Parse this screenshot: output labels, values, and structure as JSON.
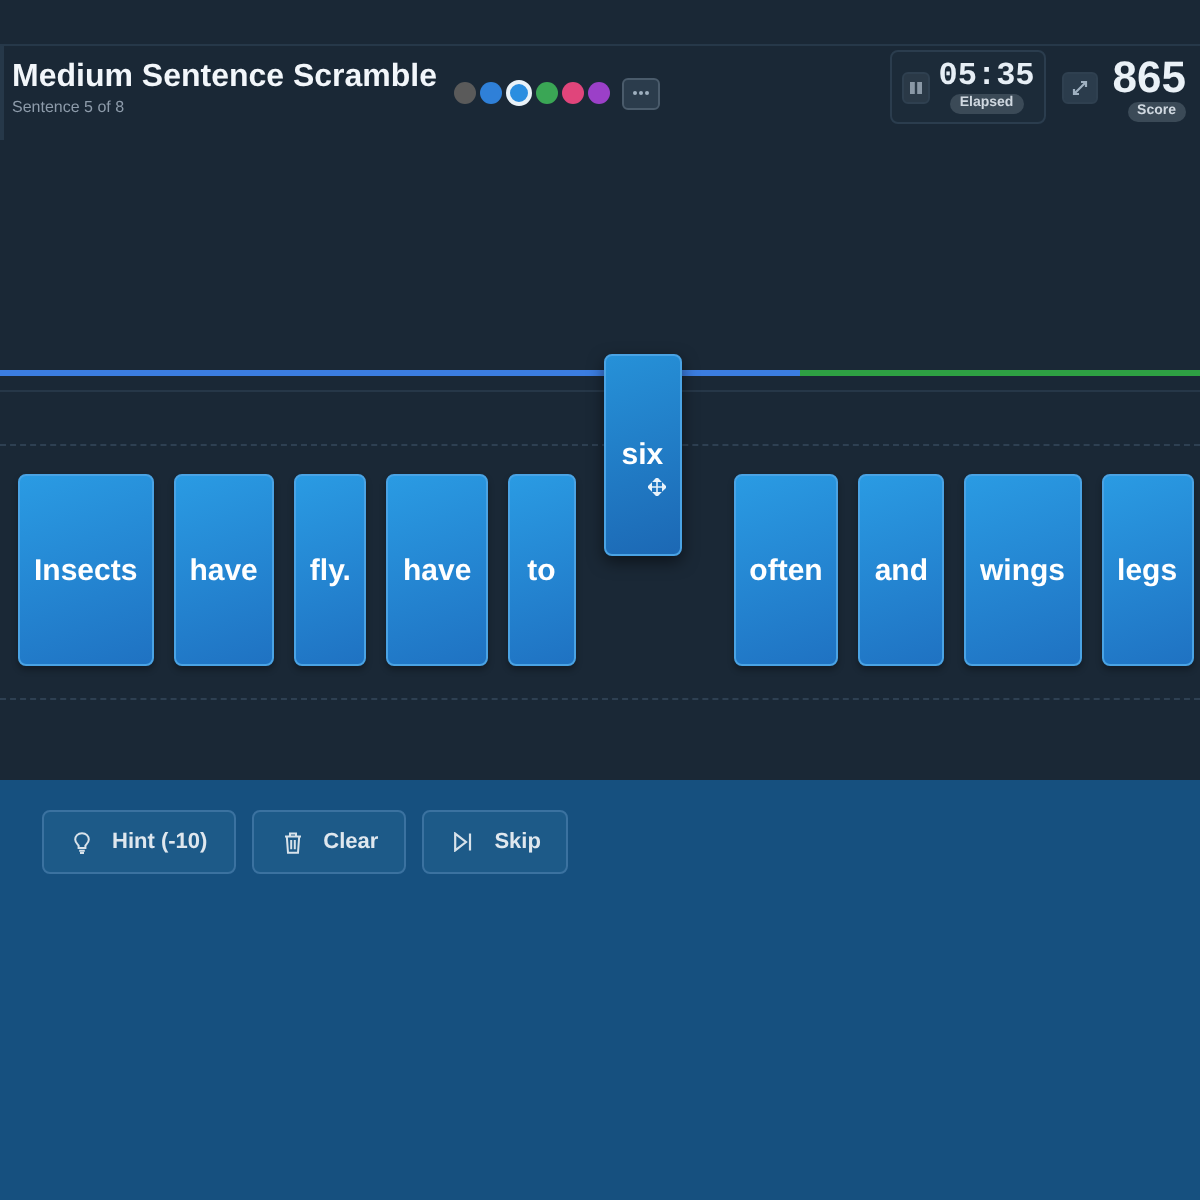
{
  "header": {
    "title": "Medium Sentence Scramble",
    "subtitle": "Sentence 5 of 8",
    "colors": [
      {
        "color": "#5a5a5a",
        "selected": false
      },
      {
        "color": "#2f80d8",
        "selected": false
      },
      {
        "color": "#2a8ee0",
        "selected": true
      },
      {
        "color": "#3aa655",
        "selected": false
      },
      {
        "color": "#e0457b",
        "selected": false
      },
      {
        "color": "#9b40c8",
        "selected": false
      }
    ]
  },
  "timer": {
    "time": "05:35",
    "label": "Elapsed"
  },
  "score": {
    "value": "865",
    "label": "Score"
  },
  "progress": {
    "level": 0.667
  },
  "words": [
    {
      "text": "Insects",
      "dragging": false
    },
    {
      "text": "have",
      "dragging": false
    },
    {
      "text": "fly.",
      "dragging": false
    },
    {
      "text": "have",
      "dragging": false
    },
    {
      "text": "to",
      "dragging": false
    },
    {
      "text": "six",
      "dragging": true
    },
    {
      "text": "often",
      "dragging": false
    },
    {
      "text": "and",
      "dragging": false
    },
    {
      "text": "wings",
      "dragging": false
    },
    {
      "text": "legs",
      "dragging": false
    }
  ],
  "buttons": [
    {
      "kind": "hint",
      "label": "Hint (-10)"
    },
    {
      "kind": "clear",
      "label": "Clear"
    },
    {
      "kind": "skip",
      "label": "Skip"
    }
  ]
}
